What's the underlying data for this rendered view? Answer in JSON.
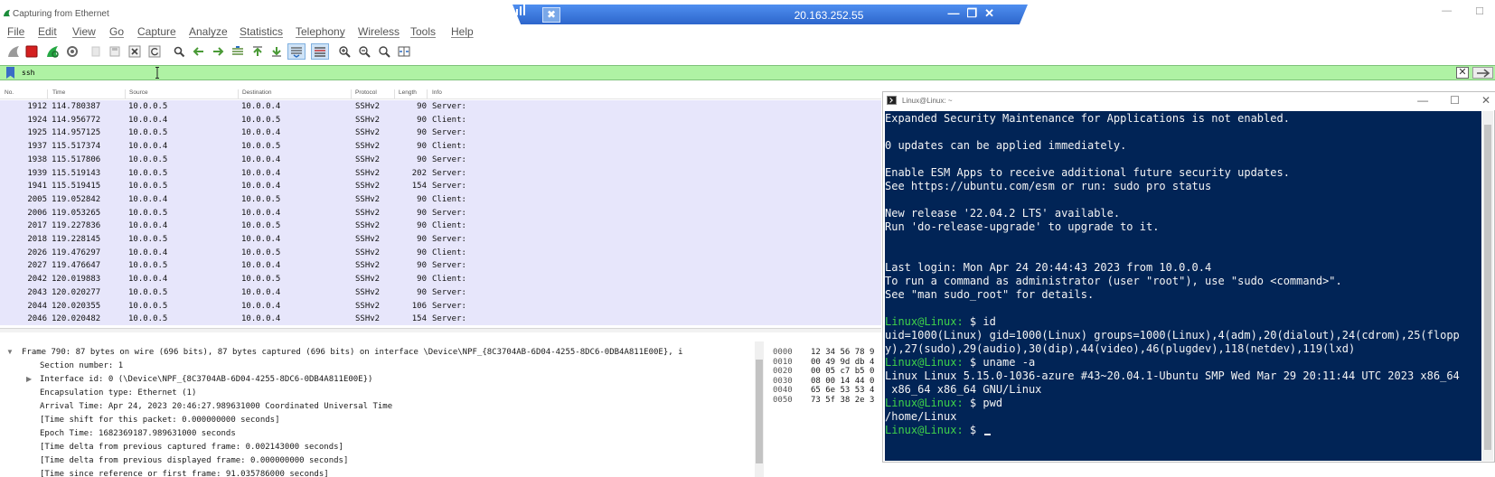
{
  "wireshark": {
    "window_title": "Capturing from Ethernet",
    "menu": [
      "File",
      "Edit",
      "View",
      "Go",
      "Capture",
      "Analyze",
      "Statistics",
      "Telephony",
      "Wireless",
      "Tools",
      "Help"
    ],
    "filter": {
      "value": "ssh"
    },
    "columns": [
      "No.",
      "Time",
      "Source",
      "Destination",
      "Protocol",
      "Length",
      "Info"
    ],
    "packets": [
      {
        "no": "1912",
        "time": "114.780387",
        "src": "10.0.0.5",
        "dst": "10.0.0.4",
        "proto": "SSHv2",
        "len": "90",
        "info": "Server:"
      },
      {
        "no": "1924",
        "time": "114.956772",
        "src": "10.0.0.4",
        "dst": "10.0.0.5",
        "proto": "SSHv2",
        "len": "90",
        "info": "Client:"
      },
      {
        "no": "1925",
        "time": "114.957125",
        "src": "10.0.0.5",
        "dst": "10.0.0.4",
        "proto": "SSHv2",
        "len": "90",
        "info": "Server:"
      },
      {
        "no": "1937",
        "time": "115.517374",
        "src": "10.0.0.4",
        "dst": "10.0.0.5",
        "proto": "SSHv2",
        "len": "90",
        "info": "Client:"
      },
      {
        "no": "1938",
        "time": "115.517806",
        "src": "10.0.0.5",
        "dst": "10.0.0.4",
        "proto": "SSHv2",
        "len": "90",
        "info": "Server:"
      },
      {
        "no": "1939",
        "time": "115.519143",
        "src": "10.0.0.5",
        "dst": "10.0.0.4",
        "proto": "SSHv2",
        "len": "202",
        "info": "Server:"
      },
      {
        "no": "1941",
        "time": "115.519415",
        "src": "10.0.0.5",
        "dst": "10.0.0.4",
        "proto": "SSHv2",
        "len": "154",
        "info": "Server:"
      },
      {
        "no": "2005",
        "time": "119.052842",
        "src": "10.0.0.4",
        "dst": "10.0.0.5",
        "proto": "SSHv2",
        "len": "90",
        "info": "Client:"
      },
      {
        "no": "2006",
        "time": "119.053265",
        "src": "10.0.0.5",
        "dst": "10.0.0.4",
        "proto": "SSHv2",
        "len": "90",
        "info": "Server:"
      },
      {
        "no": "2017",
        "time": "119.227836",
        "src": "10.0.0.4",
        "dst": "10.0.0.5",
        "proto": "SSHv2",
        "len": "90",
        "info": "Client:"
      },
      {
        "no": "2018",
        "time": "119.228145",
        "src": "10.0.0.5",
        "dst": "10.0.0.4",
        "proto": "SSHv2",
        "len": "90",
        "info": "Server:"
      },
      {
        "no": "2026",
        "time": "119.476297",
        "src": "10.0.0.4",
        "dst": "10.0.0.5",
        "proto": "SSHv2",
        "len": "90",
        "info": "Client:"
      },
      {
        "no": "2027",
        "time": "119.476647",
        "src": "10.0.0.5",
        "dst": "10.0.0.4",
        "proto": "SSHv2",
        "len": "90",
        "info": "Server:"
      },
      {
        "no": "2042",
        "time": "120.019883",
        "src": "10.0.0.4",
        "dst": "10.0.0.5",
        "proto": "SSHv2",
        "len": "90",
        "info": "Client:"
      },
      {
        "no": "2043",
        "time": "120.020277",
        "src": "10.0.0.5",
        "dst": "10.0.0.4",
        "proto": "SSHv2",
        "len": "90",
        "info": "Server:"
      },
      {
        "no": "2044",
        "time": "120.020355",
        "src": "10.0.0.5",
        "dst": "10.0.0.4",
        "proto": "SSHv2",
        "len": "106",
        "info": "Server:"
      },
      {
        "no": "2046",
        "time": "120.020482",
        "src": "10.0.0.5",
        "dst": "10.0.0.4",
        "proto": "SSHv2",
        "len": "154",
        "info": "Server:"
      }
    ],
    "details": [
      "Frame 790: 87 bytes on wire (696 bits), 87 bytes captured (696 bits) on interface \\Device\\NPF_{8C3704AB-6D04-4255-8DC6-0DB4A811E00E}, i",
      "Section number: 1",
      "Interface id: 0 (\\Device\\NPF_{8C3704AB-6D04-4255-8DC6-0DB4A811E00E})",
      "Encapsulation type: Ethernet (1)",
      "Arrival Time: Apr 24, 2023 20:46:27.989631000 Coordinated Universal Time",
      "[Time shift for this packet: 0.000000000 seconds]",
      "Epoch Time: 1682369187.989631000 seconds",
      "[Time delta from previous captured frame: 0.002143000 seconds]",
      "[Time delta from previous displayed frame: 0.000000000 seconds]",
      "[Time since reference or first frame: 91.035786000 seconds]"
    ],
    "hex": [
      {
        "offset": "0000",
        "bytes": "12 34 56 78 9"
      },
      {
        "offset": "0010",
        "bytes": "00 49 9d db 4"
      },
      {
        "offset": "0020",
        "bytes": "00 05 c7 b5 0"
      },
      {
        "offset": "0030",
        "bytes": "08 00 14 44 0"
      },
      {
        "offset": "0040",
        "bytes": "65 6e 53 53 4"
      },
      {
        "offset": "0050",
        "bytes": "73 5f 38 2e 3"
      }
    ]
  },
  "rdp": {
    "host": "20.163.252.55"
  },
  "terminal": {
    "title": "Linux@Linux: ~",
    "lines": [
      {
        "text": "Expanded Security Maintenance for Applications is not enabled."
      },
      {
        "text": ""
      },
      {
        "text": "0 updates can be applied immediately."
      },
      {
        "text": ""
      },
      {
        "text": "Enable ESM Apps to receive additional future security updates."
      },
      {
        "text": "See https://ubuntu.com/esm or run: sudo pro status"
      },
      {
        "text": ""
      },
      {
        "text": "New release '22.04.2 LTS' available."
      },
      {
        "text": "Run 'do-release-upgrade' to upgrade to it."
      },
      {
        "text": ""
      },
      {
        "text": ""
      },
      {
        "text": "Last login: Mon Apr 24 20:44:43 2023 from 10.0.0.4"
      },
      {
        "text": "To run a command as administrator (user \"root\"), use \"sudo <command>\"."
      },
      {
        "text": "See \"man sudo_root\" for details."
      },
      {
        "text": ""
      },
      {
        "prompt": "Linux@Linux:",
        "text": " $ id"
      },
      {
        "text": "uid=1000(Linux) gid=1000(Linux) groups=1000(Linux),4(adm),20(dialout),24(cdrom),25(flopp"
      },
      {
        "text": "y),27(sudo),29(audio),30(dip),44(video),46(plugdev),118(netdev),119(lxd)"
      },
      {
        "prompt": "Linux@Linux:",
        "text": " $ uname -a"
      },
      {
        "text": "Linux Linux 5.15.0-1036-azure #43~20.04.1-Ubuntu SMP Wed Mar 29 20:11:44 UTC 2023 x86_64"
      },
      {
        "text": " x86_64 x86_64 GNU/Linux"
      },
      {
        "prompt": "Linux@Linux:",
        "text": " $ pwd"
      },
      {
        "text": "/home/Linux"
      },
      {
        "prompt": "Linux@Linux:",
        "text": " $ ",
        "cursor": true
      }
    ]
  },
  "colors": {
    "filter_ok_bg": "#aff2a4",
    "packet_row_bg": "#e7e6fb",
    "terminal_bg": "#012456",
    "prompt_green": "#3fd24a",
    "rdp_bar_blue": "#2f6fd8"
  }
}
